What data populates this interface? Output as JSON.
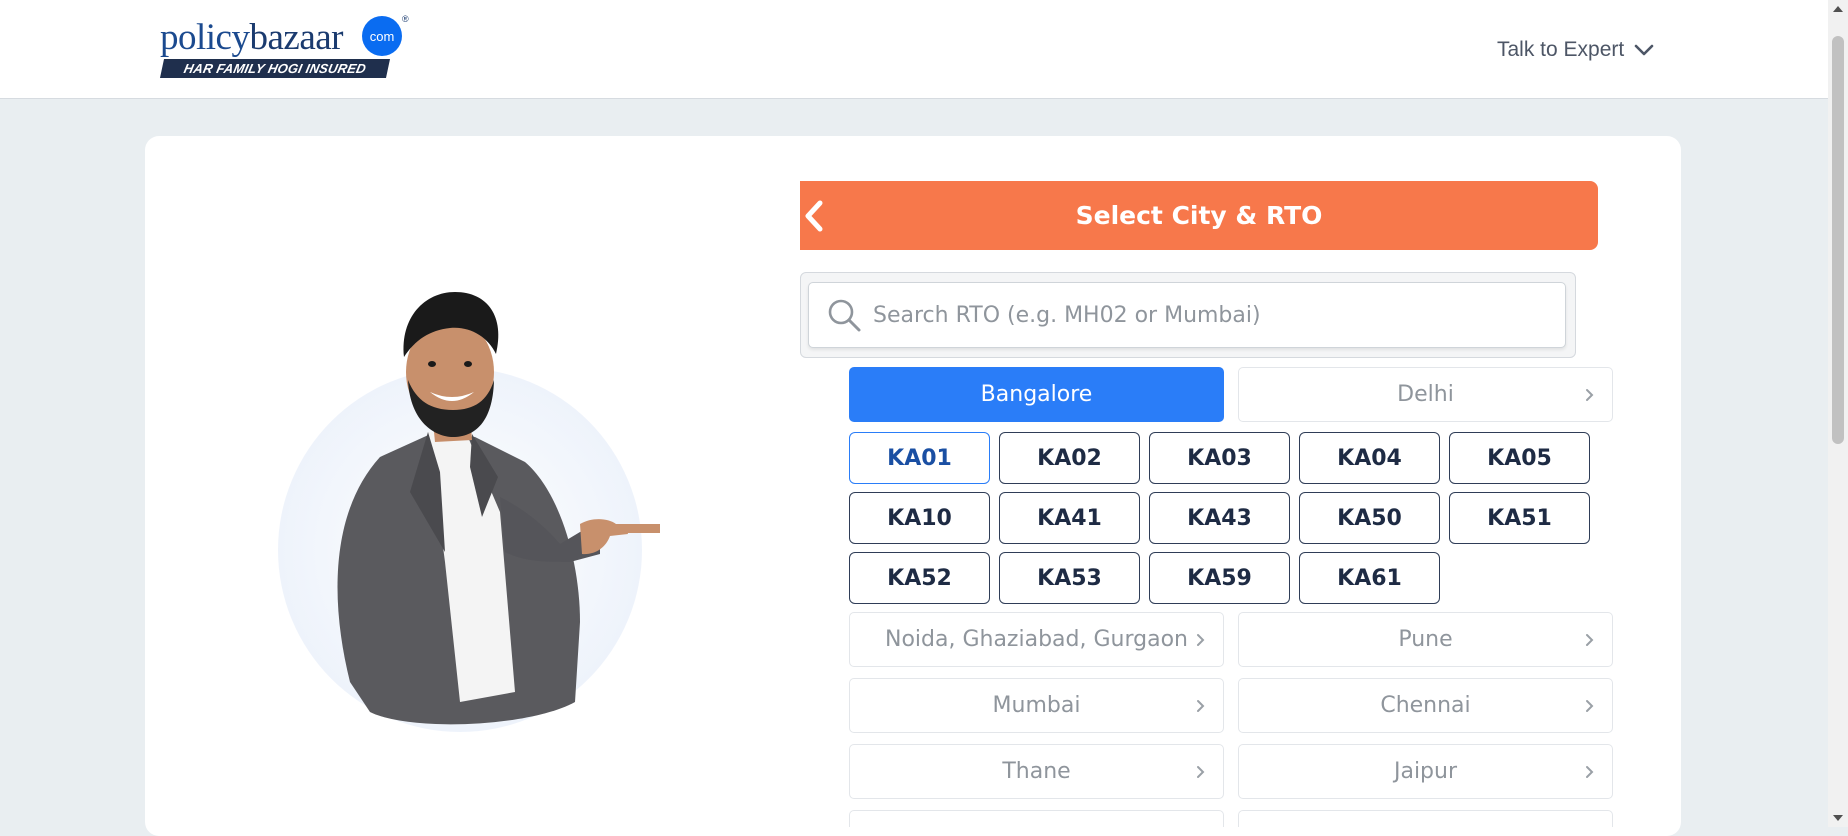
{
  "header": {
    "logo": {
      "word_policy": "policy",
      "word_bazaar": "bazaar",
      "badge": "com",
      "reg_mark": "®",
      "tagline": "HAR FAMILY HOGI INSURED"
    },
    "talk_to_expert": "Talk to Expert"
  },
  "panel": {
    "title": "Select City & RTO",
    "search_placeholder": "Search RTO (e.g. MH02 or Mumbai)",
    "search_value": "",
    "selected_city": "Bangalore",
    "selected_rto": "KA01"
  },
  "cities": [
    {
      "label": "Bangalore",
      "active": true
    },
    {
      "label": "Delhi",
      "active": false
    },
    {
      "label": "Noida, Ghaziabad, Gurgaon",
      "active": false
    },
    {
      "label": "Pune",
      "active": false
    },
    {
      "label": "Mumbai",
      "active": false
    },
    {
      "label": "Chennai",
      "active": false
    },
    {
      "label": "Thane",
      "active": false
    },
    {
      "label": "Jaipur",
      "active": false
    }
  ],
  "rto_codes": [
    "KA01",
    "KA02",
    "KA03",
    "KA04",
    "KA05",
    "KA10",
    "KA41",
    "KA43",
    "KA50",
    "KA51",
    "KA52",
    "KA53",
    "KA59",
    "KA61"
  ],
  "colors": {
    "header_orange": "#f7784b",
    "active_blue": "#2a7df8",
    "rto_border": "#2f3d57",
    "brand_blue": "#0a6cf1"
  },
  "icons": [
    "search-icon",
    "chevron-left-icon",
    "chevron-down-icon",
    "chevron-right-icon"
  ]
}
